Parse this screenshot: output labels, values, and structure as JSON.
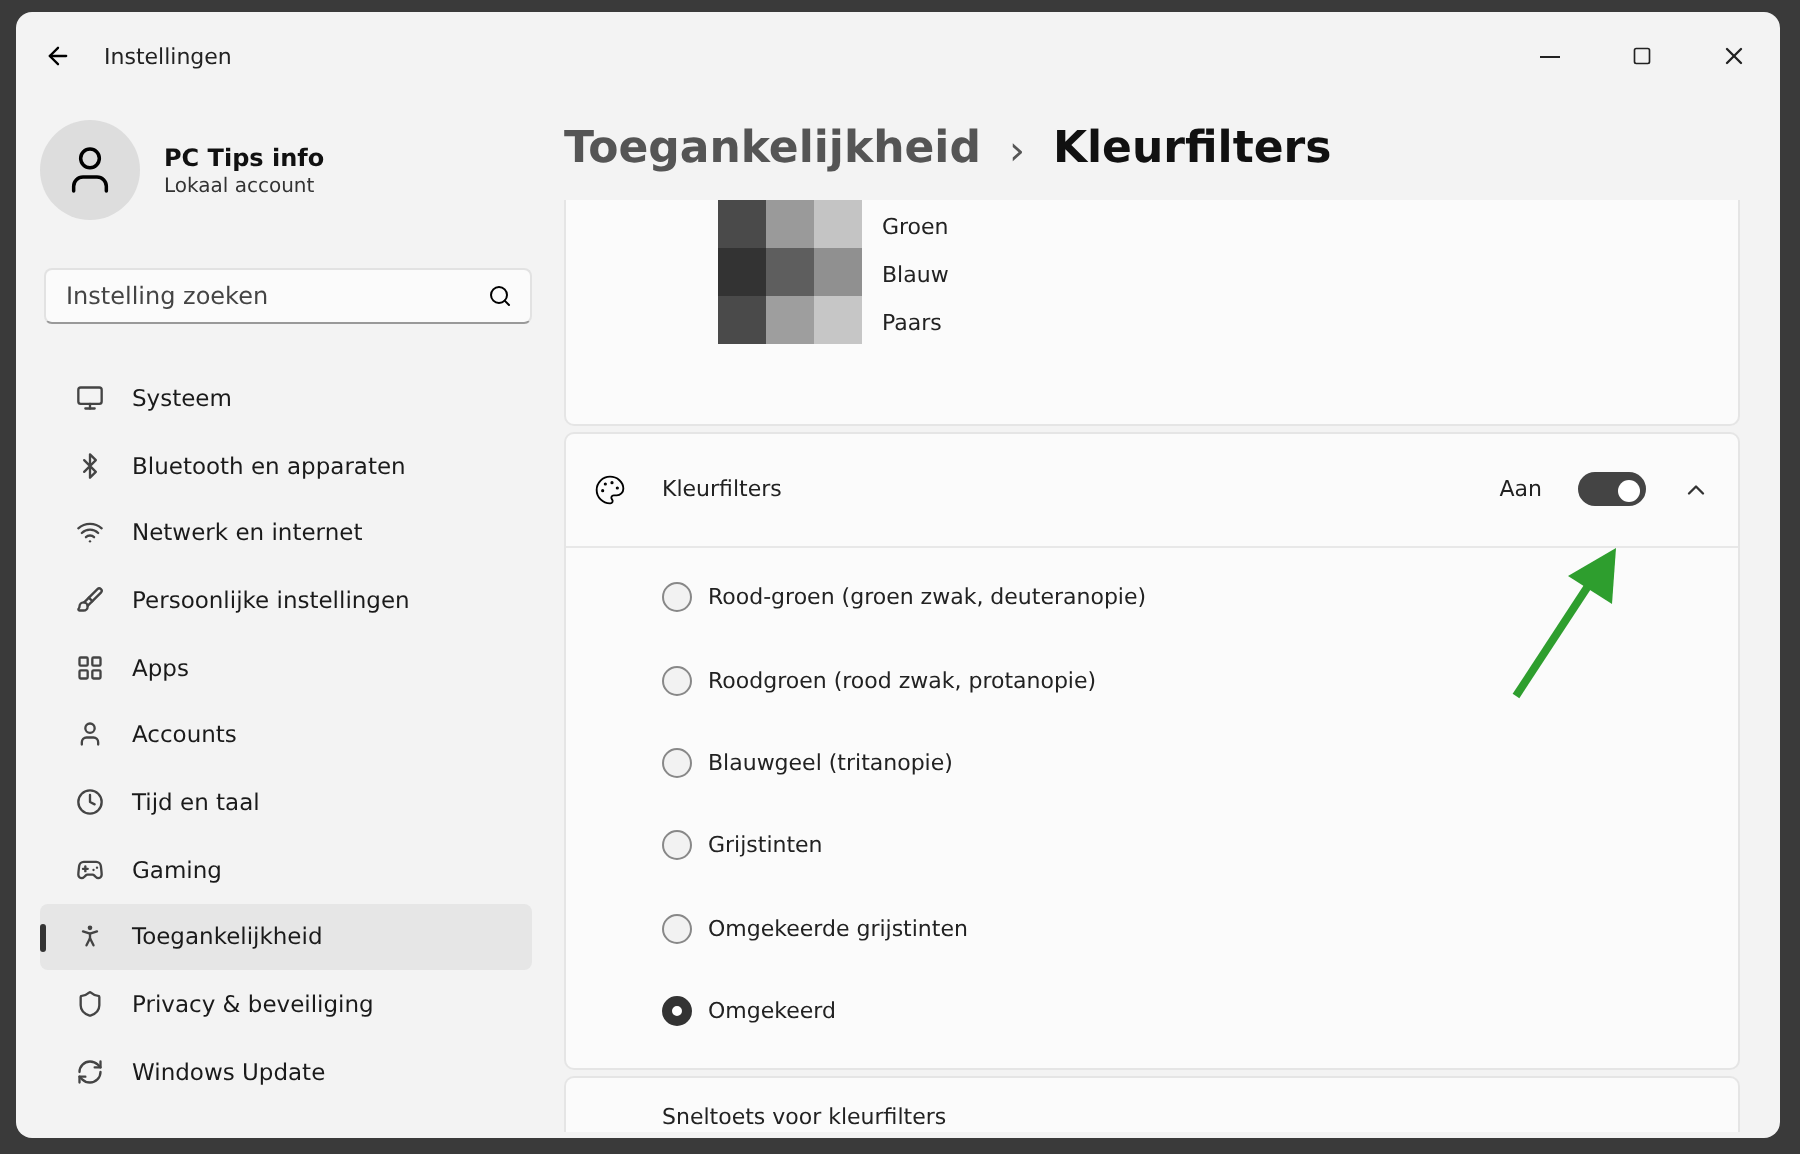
{
  "window": {
    "title": "Instellingen"
  },
  "account": {
    "name": "PC Tips info",
    "type": "Lokaal account"
  },
  "search": {
    "placeholder": "Instelling zoeken"
  },
  "sidebar": {
    "items": [
      {
        "label": "Systeem",
        "selected": false
      },
      {
        "label": "Bluetooth en apparaten",
        "selected": false
      },
      {
        "label": "Netwerk en internet",
        "selected": false
      },
      {
        "label": "Persoonlijke instellingen",
        "selected": false
      },
      {
        "label": "Apps",
        "selected": false
      },
      {
        "label": "Accounts",
        "selected": false
      },
      {
        "label": "Tijd en taal",
        "selected": false
      },
      {
        "label": "Gaming",
        "selected": false
      },
      {
        "label": "Toegankelijkheid",
        "selected": true
      },
      {
        "label": "Privacy & beveiliging",
        "selected": false
      },
      {
        "label": "Windows Update",
        "selected": false
      }
    ]
  },
  "breadcrumb": {
    "parent": "Toegankelijkheid",
    "separator": "›",
    "current": "Kleurfilters"
  },
  "preview": {
    "labels": [
      "Groen",
      "Blauw",
      "Paars"
    ]
  },
  "color_filters": {
    "label": "Kleurfilters",
    "state_text": "Aan",
    "on": true,
    "expanded": true,
    "options": [
      {
        "label": "Rood-groen (groen zwak, deuteranopie)",
        "selected": false
      },
      {
        "label": "Roodgroen (rood zwak, protanopie)",
        "selected": false
      },
      {
        "label": "Blauwgeel (tritanopie)",
        "selected": false
      },
      {
        "label": "Grijstinten",
        "selected": false
      },
      {
        "label": "Omgekeerde grijstinten",
        "selected": false
      },
      {
        "label": "Omgekeerd",
        "selected": true
      }
    ]
  },
  "shortcut": {
    "label": "Sneltoets voor kleurfilters"
  }
}
